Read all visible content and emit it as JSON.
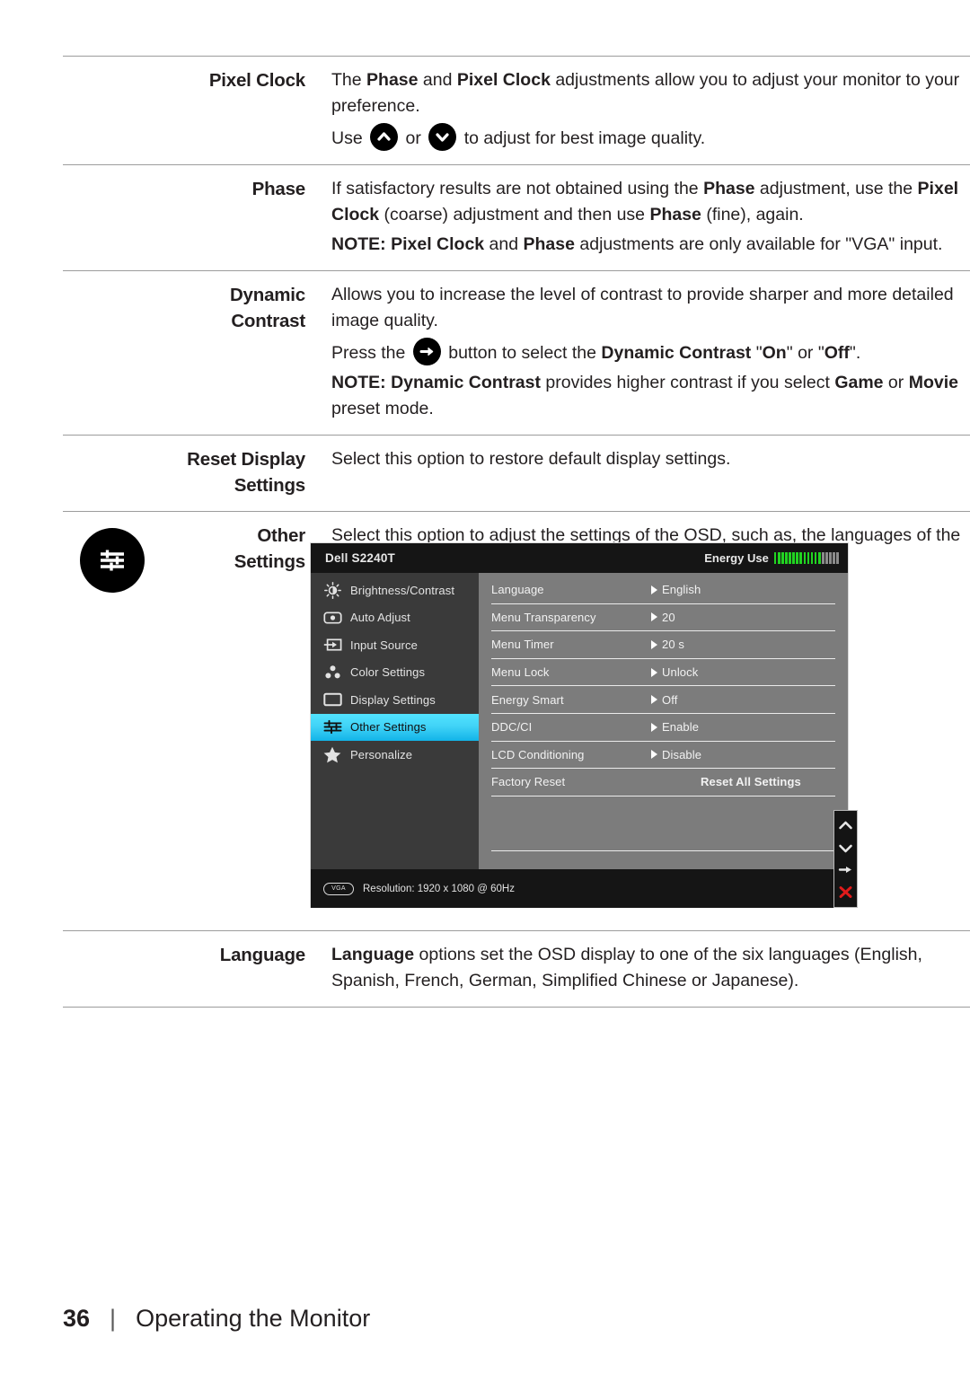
{
  "page": {
    "number": "36",
    "separator": "|",
    "section_title": "Operating the Monitor"
  },
  "rows": [
    {
      "label": "Pixel Clock",
      "paragraphs": [
        "The Phase and Pixel Clock adjustments allow you to adjust your monitor to your preference.",
        "Use ^ or v to adjust for best image quality."
      ]
    },
    {
      "label": "Phase",
      "paragraphs": [
        "If satisfactory results are not obtained using the Phase adjustment, use the Pixel Clock (coarse) adjustment and then use Phase (fine), again.",
        "NOTE: Pixel Clock and Phase adjustments are only available for \"VGA\" input."
      ]
    },
    {
      "label": "Dynamic Contrast",
      "paragraphs": [
        "Allows you to increase the level of contrast to provide sharper and more detailed image quality.",
        "Press the -> button to select the Dynamic Contrast \"On\" or \"Off\".",
        "NOTE: Dynamic Contrast provides higher contrast if you select Game or Movie preset mode."
      ]
    },
    {
      "label": "Reset Display Settings",
      "paragraphs": [
        "Select this option to restore default display settings."
      ]
    },
    {
      "label": "Other Settings",
      "paragraphs": [
        "Select this option to adjust the settings of the OSD, such as, the languages of the OSD, the amount of time the menu remains on screen, and so on."
      ]
    },
    {
      "label": "Language",
      "paragraphs": [
        "Language options set the OSD display to one of the six languages (English, Spanish, French, German, Simplified Chinese or Japanese)."
      ]
    }
  ],
  "text": {
    "pixel_clock_label": "Pixel Clock",
    "pixel_clock_p1_a": "The ",
    "pixel_clock_p1_b1": "Phase",
    "pixel_clock_p1_c": " and ",
    "pixel_clock_p1_b2": "Pixel Clock",
    "pixel_clock_p1_d": " adjustments allow you to adjust your monitor to your preference.",
    "pixel_clock_use": "Use",
    "pixel_clock_or": "or",
    "pixel_clock_tail": "to adjust for best image quality.",
    "phase_label": "Phase",
    "phase_p1_a": "If satisfactory results are not obtained using the ",
    "phase_p1_b1": "Phase",
    "phase_p1_b": " adjustment, use the ",
    "phase_p1_b2": "Pixel Clock",
    "phase_p1_c": " (coarse) adjustment and then use ",
    "phase_p1_b3": "Phase",
    "phase_p1_d": " (fine), again.",
    "phase_note_lead": "NOTE:",
    "phase_note_b1": " Pixel Clock",
    "phase_note_a": " and ",
    "phase_note_b2": "Phase",
    "phase_note_tail": " adjustments are only available for \"VGA\" input.",
    "dyn_label_l1": "Dynamic",
    "dyn_label_l2": "Contrast",
    "dyn_p1": "Allows you to increase the level of contrast to provide sharper and more detailed image quality.",
    "dyn_press": "Press the",
    "dyn_p2_a": "button to select the ",
    "dyn_p2_b1": "Dynamic Contrast",
    "dyn_p2_b": " \"",
    "dyn_p2_b2": "On",
    "dyn_p2_c": "\" or \"",
    "dyn_p2_b3": "Off",
    "dyn_p2_d": "\".",
    "dyn_note_lead": "NOTE:",
    "dyn_note_b1": " Dynamic Contrast",
    "dyn_note_a": " provides higher contrast if you select ",
    "dyn_note_b2": "Game",
    "dyn_note_b": " or ",
    "dyn_note_b3": "Movie",
    "dyn_note_tail": " preset mode.",
    "reset_label_l1": "Reset Display",
    "reset_label_l2": "Settings",
    "reset_desc": "Select this option to restore default display settings.",
    "other_label_l1": "Other",
    "other_label_l2": "Settings",
    "other_desc": "Select this option to adjust the settings of the OSD, such as, the languages of the OSD, the amount of time the menu remains on screen, and so on.",
    "lang_label": "Language",
    "lang_b1": "Language",
    "lang_desc": " options set the OSD display to one of the six languages (English, Spanish, French, German, Simplified Chinese or Japanese)."
  },
  "osd": {
    "model": "Dell S2240T",
    "energy_label": "Energy Use",
    "energy_bars_on": 13,
    "energy_bars_off": 5,
    "menu": [
      {
        "icon": "brightness-icon",
        "label": "Brightness/Contrast",
        "selected": false
      },
      {
        "icon": "auto-adjust-icon",
        "label": "Auto Adjust",
        "selected": false
      },
      {
        "icon": "input-source-icon",
        "label": "Input Source",
        "selected": false
      },
      {
        "icon": "color-settings-icon",
        "label": "Color Settings",
        "selected": false
      },
      {
        "icon": "display-settings-icon",
        "label": "Display Settings",
        "selected": false
      },
      {
        "icon": "other-settings-icon",
        "label": "Other Settings",
        "selected": true
      },
      {
        "icon": "personalize-star-icon",
        "label": "Personalize",
        "selected": false
      }
    ],
    "options": [
      {
        "name": "Language",
        "value": "English",
        "has_caret": true
      },
      {
        "name": "Menu Transparency",
        "value": "20",
        "has_caret": true
      },
      {
        "name": "Menu Timer",
        "value": "20 s",
        "has_caret": true
      },
      {
        "name": "Menu Lock",
        "value": "Unlock",
        "has_caret": true
      },
      {
        "name": "Energy Smart",
        "value": "Off",
        "has_caret": true
      },
      {
        "name": "DDC/CI",
        "value": "Enable",
        "has_caret": true
      },
      {
        "name": "LCD Conditioning",
        "value": "Disable",
        "has_caret": true
      },
      {
        "name": "Factory Reset",
        "value": "Reset All Settings",
        "has_caret": false
      }
    ],
    "footer": {
      "connector": "VGA",
      "resolution": "Resolution: 1920 x 1080 @ 60Hz"
    },
    "nav_buttons": [
      "up-arrow",
      "down-arrow",
      "right-arrow",
      "close-x"
    ],
    "colors": {
      "highlight": "#41d3f7",
      "energy_on": "#21d421",
      "energy_off": "#8b8b8b",
      "close_x": "#e01b1b",
      "header_bg": "#151515",
      "left_bg": "#3a3a3a",
      "right_bg": "#7c7c7c"
    }
  }
}
